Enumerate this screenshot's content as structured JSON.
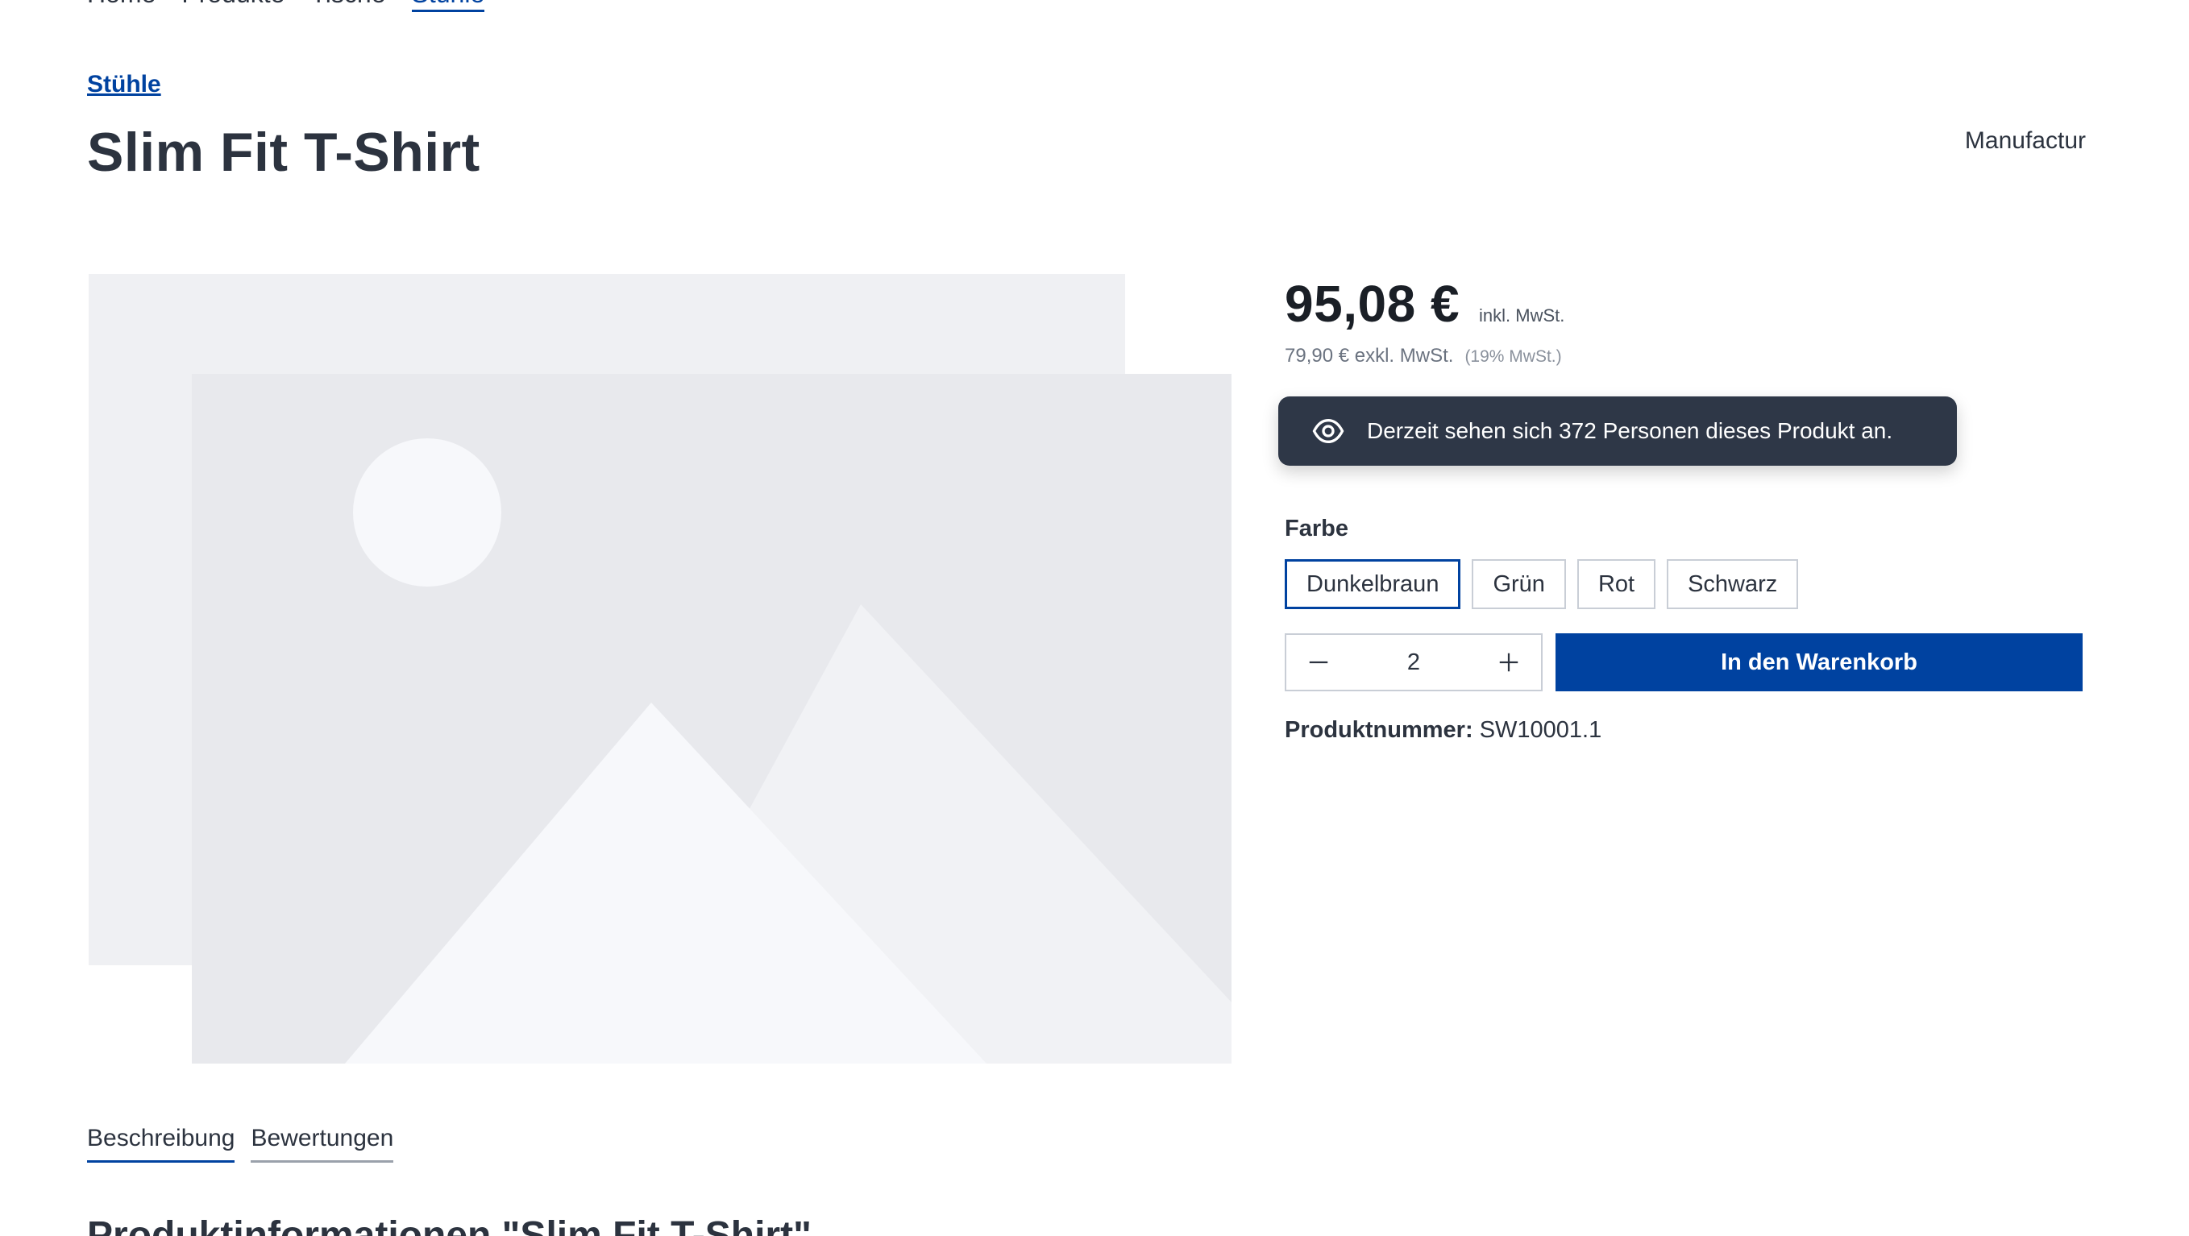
{
  "nav": {
    "items": [
      "Home",
      "Produkte",
      "Tische",
      "Stühle"
    ]
  },
  "breadcrumb": "Stühle",
  "product": {
    "title": "Slim Fit T-Shirt",
    "manufacturer": "Manufactur",
    "price": "95,08 €",
    "price_incl_label": "inkl. MwSt.",
    "price_net": "79,90 € exkl. MwSt.",
    "vat_note": "(19% MwSt.)",
    "viewers_text": "Derzeit sehen sich 372 Personen dieses Produkt an.",
    "variant_label": "Farbe",
    "variants": [
      "Dunkelbraun",
      "Grün",
      "Rot",
      "Schwarz"
    ],
    "selected_variant": "Dunkelbraun",
    "quantity": "2",
    "add_to_cart_label": "In den Warenkorb",
    "sku_label": "Produktnummer:",
    "sku_value": "SW10001.1"
  },
  "tabs": [
    "Beschreibung",
    "Bewertungen"
  ],
  "section_title": "Produktinformationen \"Slim Fit T-Shirt\"",
  "colors": {
    "accent": "#0042a0",
    "text": "#2c333f",
    "tooltip_bg": "#2e3747"
  },
  "icons": {
    "viewers": "eye-icon",
    "minus": "minus-icon",
    "plus": "plus-icon"
  }
}
